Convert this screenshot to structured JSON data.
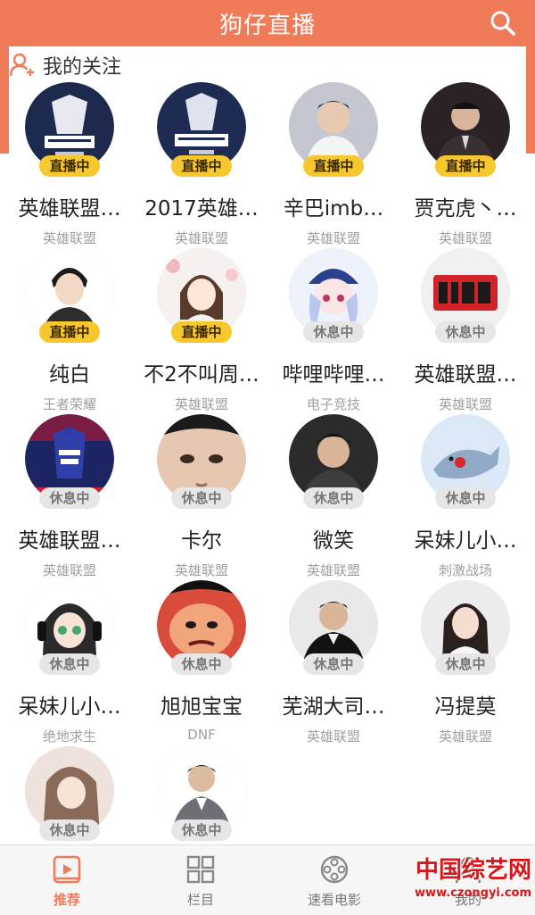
{
  "header": {
    "title": "狗仔直播"
  },
  "section": {
    "title": "我的关注"
  },
  "status_labels": {
    "live": "直播中",
    "rest": "休息中"
  },
  "streamers": [
    {
      "name": "英雄联盟…",
      "category": "英雄联盟",
      "status": "直播中",
      "live": true,
      "avatar": "worlds-2018-logo"
    },
    {
      "name": "2017英雄…",
      "category": "英雄联盟",
      "status": "直播中",
      "live": true,
      "avatar": "worlds-championship-logo"
    },
    {
      "name": "辛巴imb…",
      "category": "英雄联盟",
      "status": "直播中",
      "live": true,
      "avatar": "person-white-sweater"
    },
    {
      "name": "贾克虎丶…",
      "category": "英雄联盟",
      "status": "直播中",
      "live": true,
      "avatar": "person-dark-suit"
    },
    {
      "name": "纯白",
      "category": "王者荣耀",
      "status": "直播中",
      "live": true,
      "avatar": "anime-boy"
    },
    {
      "name": "不2不叫周…",
      "category": "英雄联盟",
      "status": "直播中",
      "live": true,
      "avatar": "anime-girl-flowers"
    },
    {
      "name": "哔哩哔哩…",
      "category": "电子竞技",
      "status": "休息中",
      "live": false,
      "avatar": "anime-blue-hat-girl"
    },
    {
      "name": "英雄联盟…",
      "category": "英雄联盟",
      "status": "休息中",
      "live": false,
      "avatar": "riot-logo"
    },
    {
      "name": "英雄联盟…",
      "category": "英雄联盟",
      "status": "休息中",
      "live": false,
      "avatar": "all-star-logo"
    },
    {
      "name": "卡尔",
      "category": "英雄联盟",
      "status": "休息中",
      "live": false,
      "avatar": "face-closeup"
    },
    {
      "name": "微笑",
      "category": "英雄联盟",
      "status": "休息中",
      "live": false,
      "avatar": "young-man-portrait"
    },
    {
      "name": "呆妹儿小…",
      "category": "刺激战场",
      "status": "休息中",
      "live": false,
      "avatar": "shark-cartoon"
    },
    {
      "name": "呆妹儿小…",
      "category": "绝地求生",
      "status": "休息中",
      "live": false,
      "avatar": "anime-girl-headphones"
    },
    {
      "name": "旭旭宝宝",
      "category": "DNF",
      "status": "休息中",
      "live": false,
      "avatar": "cartoon-angry-face"
    },
    {
      "name": "芜湖大司…",
      "category": "英雄联盟",
      "status": "休息中",
      "live": false,
      "avatar": "man-suit"
    },
    {
      "name": "冯提莫",
      "category": "英雄联盟",
      "status": "休息中",
      "live": false,
      "avatar": "woman-portrait"
    },
    {
      "name": "",
      "category": "",
      "status": "休息中",
      "live": false,
      "avatar": "woman-selfie"
    },
    {
      "name": "",
      "category": "",
      "status": "休息中",
      "live": false,
      "avatar": "man-plaid-suit"
    }
  ],
  "bottom_nav": [
    {
      "label": "推荐",
      "icon": "play-screen-icon",
      "active": true
    },
    {
      "label": "栏目",
      "icon": "grid-icon",
      "active": false
    },
    {
      "label": "速看电影",
      "icon": "film-reel-icon",
      "active": false
    },
    {
      "label": "我的",
      "icon": "user-icon",
      "active": false
    }
  ],
  "watermark": {
    "main": "中国综艺网",
    "sub": "www.czongyi.com"
  },
  "colors": {
    "brand": "#f07b59",
    "live_badge": "#f7c72e",
    "rest_badge": "#e6e6e6"
  }
}
